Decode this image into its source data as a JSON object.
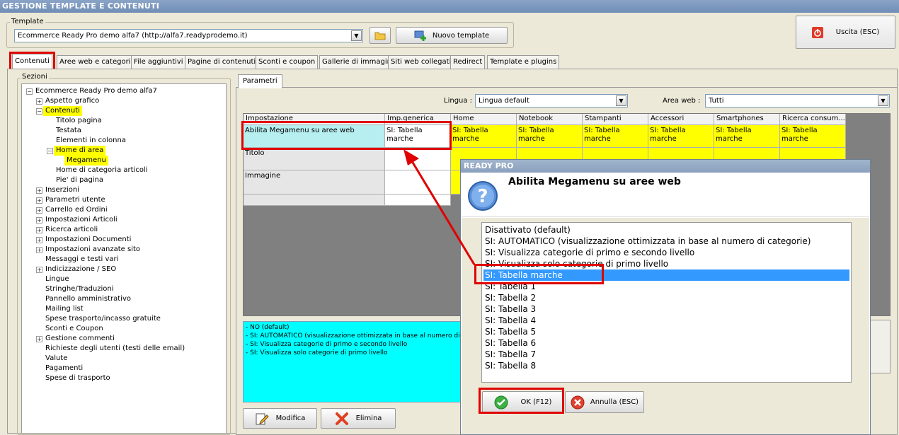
{
  "window": {
    "title": "GESTIONE TEMPLATE E CONTENUTI"
  },
  "template": {
    "group_label": "Template",
    "selected": "Ecommerce Ready Pro demo alfa7 (http://alfa7.readyprodemo.it)",
    "new_button": "Nuovo template"
  },
  "exit_button": "Uscita (ESC)",
  "tabs": [
    "Contenuti",
    "Aree web e categorie",
    "File aggiuntivi",
    "Pagine di contenuti",
    "Sconti e coupon",
    "Gallerie di immagini",
    "Siti web collegati",
    "Redirect",
    "Template e plugins"
  ],
  "sections": {
    "label": "Sezioni",
    "tree": [
      {
        "label": "Ecommerce Ready Pro demo alfa7",
        "level": 0,
        "exp": "-"
      },
      {
        "label": "Aspetto grafico",
        "level": 1,
        "exp": "+"
      },
      {
        "label": "Contenuti",
        "level": 1,
        "exp": "-",
        "hl": true
      },
      {
        "label": "Titolo pagina",
        "level": 2
      },
      {
        "label": "Testata",
        "level": 2
      },
      {
        "label": "Elementi in colonna",
        "level": 2
      },
      {
        "label": "Home di area",
        "level": 2,
        "exp": "-",
        "hl": true
      },
      {
        "label": "Megamenu",
        "level": 3,
        "hl": true
      },
      {
        "label": "Home di categoria articoli",
        "level": 2
      },
      {
        "label": "Pie' di pagina",
        "level": 2
      },
      {
        "label": "Inserzioni",
        "level": 1,
        "exp": "+"
      },
      {
        "label": "Parametri utente",
        "level": 1,
        "exp": "+"
      },
      {
        "label": "Carrello ed Ordini",
        "level": 1,
        "exp": "+"
      },
      {
        "label": "Impostazioni Articoli",
        "level": 1,
        "exp": "+"
      },
      {
        "label": "Ricerca articoli",
        "level": 1,
        "exp": "+"
      },
      {
        "label": "Impostazioni Documenti",
        "level": 1,
        "exp": "+"
      },
      {
        "label": "Impostazioni avanzate sito",
        "level": 1,
        "exp": "+"
      },
      {
        "label": "Messaggi e testi vari",
        "level": 1
      },
      {
        "label": "Indicizzazione / SEO",
        "level": 1,
        "exp": "+"
      },
      {
        "label": "Lingue",
        "level": 1
      },
      {
        "label": "Stringhe/Traduzioni",
        "level": 1
      },
      {
        "label": "Pannello amministrativo",
        "level": 1
      },
      {
        "label": "Mailing list",
        "level": 1
      },
      {
        "label": "Spese trasporto/incasso gratuite",
        "level": 1
      },
      {
        "label": "Sconti e Coupon",
        "level": 1
      },
      {
        "label": "Gestione commenti",
        "level": 1,
        "exp": "+"
      },
      {
        "label": "Richieste degli utenti (testi delle email)",
        "level": 1
      },
      {
        "label": "Valute",
        "level": 1
      },
      {
        "label": "Pagamenti",
        "level": 1
      },
      {
        "label": "Spese di trasporto",
        "level": 1
      }
    ]
  },
  "params": {
    "tab": "Parametri",
    "lingua_label": "Lingua :",
    "lingua_value": "Lingua default",
    "area_label": "Area web :",
    "area_value": "Tutti",
    "columns": [
      "Impostazione",
      "Imp.generica",
      "Home",
      "Notebook",
      "Stampanti",
      "Accessori",
      "Smartphones",
      "Ricerca consum..."
    ],
    "rows": [
      {
        "name": "Abilita Megamenu su aree web",
        "generic": "SI: Tabella marche",
        "values": [
          "SI: Tabella marche",
          "SI: Tabella marche",
          "SI: Tabella marche",
          "SI: Tabella marche",
          "SI: Tabella marche",
          "SI: Tabella marche"
        ]
      },
      {
        "name": "Titolo",
        "generic": "",
        "values": [
          "",
          "",
          "",
          "",
          "",
          ""
        ]
      },
      {
        "name": "Immagine",
        "generic": "",
        "values": [
          "",
          "",
          "",
          "",
          "",
          ""
        ]
      }
    ],
    "description": [
      "- NO (default)",
      "- SI: AUTOMATICO (visualizzazione ottimizzata in base al numero di",
      "- SI: Visualizza categorie di primo e secondo livello",
      "- SI: Visualizza solo categorie di primo livello"
    ],
    "edit_button": "Modifica",
    "delete_button": "Elimina"
  },
  "dialog": {
    "title": "READY PRO",
    "heading": "Abilita Megamenu su aree web",
    "options": [
      "Disattivato (default)",
      "SI: AUTOMATICO (visualizzazione ottimizzata in base al numero di categorie)",
      "SI: Visualizza categorie di primo e secondo livello",
      "SI: Visualizza solo categorie di primo livello",
      "SI: Tabella marche",
      "SI: Tabella 1",
      "SI: Tabella 2",
      "SI: Tabella 3",
      "SI: Tabella 4",
      "SI: Tabella 5",
      "SI: Tabella 6",
      "SI: Tabella 7",
      "SI: Tabella 8"
    ],
    "selected_index": 4,
    "ok_button": "OK (F12)",
    "cancel_button": "Annulla (ESC)"
  },
  "colors": {
    "highlight_yellow": "#ffff00",
    "cyan": "#00ffff",
    "row_cyan": "#b7eef0",
    "red_annotation": "#e00000",
    "selection_blue": "#3399ff"
  }
}
